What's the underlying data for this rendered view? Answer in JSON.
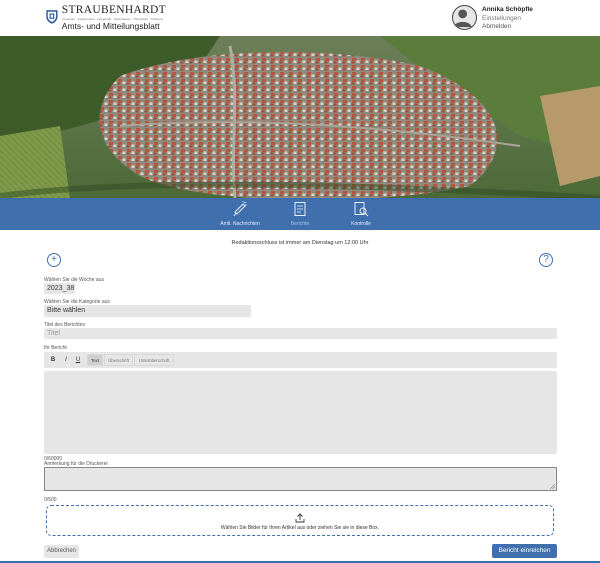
{
  "header": {
    "brand": "STRAUBENHARDT",
    "places": "Conweiler · Feldrennach · Langenalb · Ottenhausen · Pfinzweiler · Schwann",
    "subtitle": "Amts- und Mitteilungsblatt"
  },
  "user": {
    "name": "Annika Schöpfle",
    "settings": "Einstellungen",
    "logout": "Abmelden"
  },
  "nav": {
    "items": [
      {
        "label": "Amtl. Nachrichten",
        "icon": "megaphone-icon",
        "active": false
      },
      {
        "label": "Berichte",
        "icon": "document-icon",
        "active": true
      },
      {
        "label": "Kontrolle",
        "icon": "review-icon",
        "active": false
      }
    ]
  },
  "notice": "Redaktionsschluss ist immer am Dienstag um 12:00 Uhr",
  "form": {
    "week_label": "Wählen Sie die Woche aus",
    "week_value": "2023_38",
    "category_label": "Wählen Sie die Kategorie aus",
    "category_value": "Bitte wählen",
    "title_label": "Titel des Berichtes",
    "title_placeholder": "Titel",
    "report_label": "Ihr Bericht",
    "toolbar": {
      "bold": "B",
      "italic": "I",
      "underline": "U",
      "format_text": "Text",
      "format_heading": "Überschrift",
      "format_subheading": "Unterüberschrift"
    },
    "report_counter": "0/60000",
    "note_label": "Anmerkung für die Druckerei",
    "note_counter": "0/500",
    "upload_text": "Wählen Sie Bilder für Ihren Artikel aus oder ziehen Sie sie in diese Box.",
    "cancel": "Abbrechen",
    "submit": "Bericht einreichen"
  },
  "icons": {
    "add": "+",
    "help": "?"
  },
  "colors": {
    "accent": "#3f6fad",
    "field_bg": "#e6e6e6"
  }
}
